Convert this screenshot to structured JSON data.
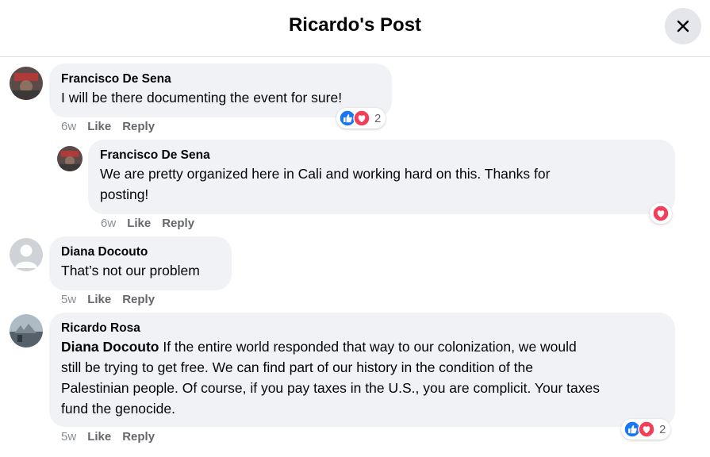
{
  "header": {
    "title": "Ricardo's Post"
  },
  "comments": [
    {
      "author": "Francisco De Sena",
      "text": "I will be there documenting the event for sure!",
      "time": "6w",
      "like": "Like",
      "reply": "Reply",
      "reaction_count": "2"
    },
    {
      "author": "Francisco De Sena",
      "text_line1": "We are pretty organized here in Cali and working hard on this. Thanks for",
      "text_line2": "posting!",
      "time": "6w",
      "like": "Like",
      "reply": "Reply"
    },
    {
      "author": "Diana Docouto",
      "text": "That’s not our problem",
      "time": "5w",
      "like": "Like",
      "reply": "Reply"
    },
    {
      "author": "Ricardo Rosa",
      "mention": "Diana Docouto",
      "text_line1": " If the entire world responded that way to our colonization, we would",
      "text_line2": "still be trying to get free. We can find part of our history in the condition of the",
      "text_line3": "Palestinian people. Of course, if you pay taxes in the U.S., you are complicit. Your taxes",
      "text_line4": "fund the genocide.",
      "time": "5w",
      "like": "Like",
      "reply": "Reply",
      "reaction_count": "2"
    }
  ],
  "colors": {
    "like_blue": "#1877f2",
    "love_red": "#f33e58",
    "bubble": "#f0f2f5",
    "meta_gray": "#65676b"
  }
}
